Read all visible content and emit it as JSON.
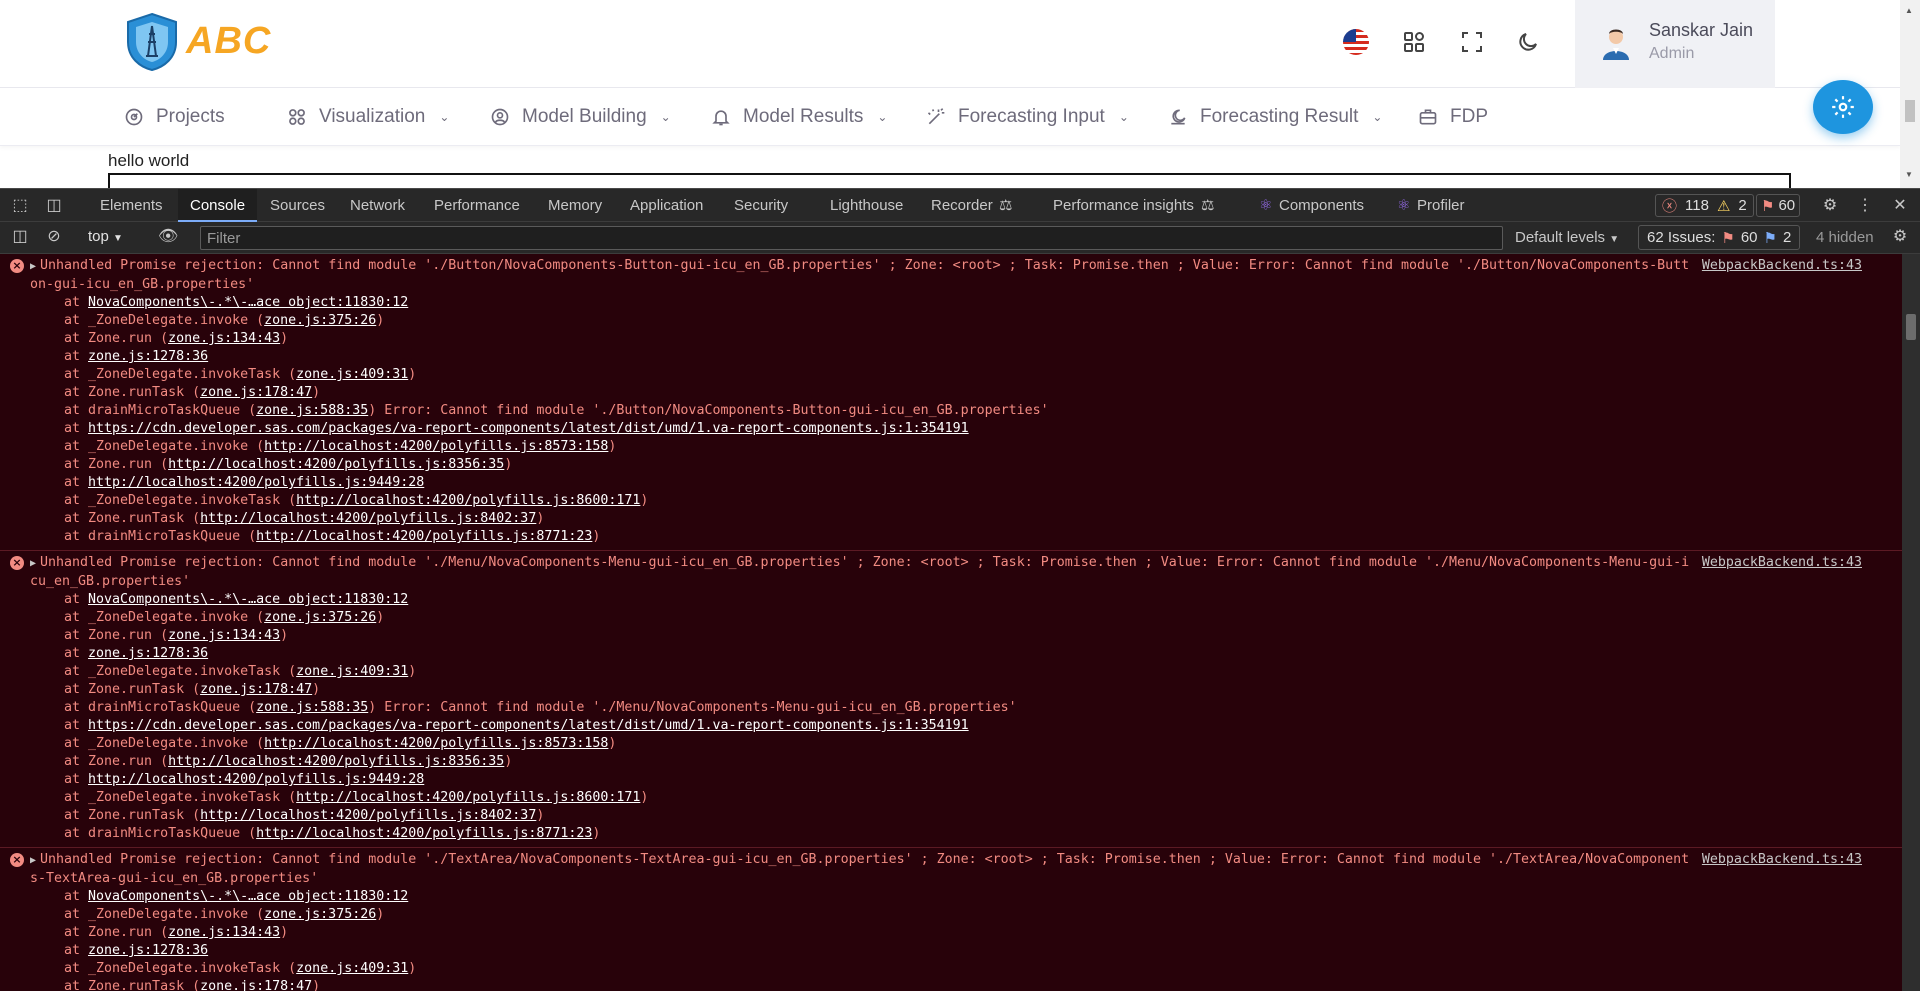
{
  "app": {
    "brand": "ABC",
    "user": {
      "name": "Sanskar Jain",
      "role": "Admin"
    },
    "nav": [
      {
        "label": "Projects",
        "icon": "target-icon",
        "has_chevron": false
      },
      {
        "label": "Visualization",
        "icon": "apps-icon",
        "has_chevron": true
      },
      {
        "label": "Model Building",
        "icon": "user-circle-icon",
        "has_chevron": true
      },
      {
        "label": "Model Results",
        "icon": "bell-icon",
        "has_chevron": true
      },
      {
        "label": "Forecasting Input",
        "icon": "magic-wand-icon",
        "has_chevron": true
      },
      {
        "label": "Forecasting Result",
        "icon": "crescent-chart-icon",
        "has_chevron": true
      },
      {
        "label": "FDP",
        "icon": "briefcase-icon",
        "has_chevron": false
      }
    ],
    "content_text": "hello world",
    "accent": "#1e95df",
    "brand_color": "#f6a623"
  },
  "devtools": {
    "tabs": [
      "Elements",
      "Console",
      "Sources",
      "Network",
      "Performance",
      "Memory",
      "Application",
      "Security",
      "Lighthouse",
      "Recorder",
      "Performance insights",
      "Components",
      "Profiler"
    ],
    "active_tab": "Console",
    "errors_count": "118",
    "warnings_count": "2",
    "messages_count": "60",
    "context": "top",
    "filter_placeholder": "Filter",
    "levels": "Default levels",
    "issues_label": "62 Issues:",
    "issues_errors": "60",
    "issues_info": "2",
    "hidden": "4 hidden",
    "messages": [
      {
        "head": "Unhandled Promise rejection: Cannot find module './Button/NovaComponents-Button-gui-icu_en_GB.properties' ; Zone: <root> ; Task: Promise.then ; Value: Error: Cannot find module './Button/NovaComponents-Button-gui-icu_en_GB.properties'",
        "source": "WebpackBackend.ts:43",
        "frames": [
          {
            "pre": "at ",
            "link": "NovaComponents\\-.*\\-…ace object:11830:12",
            "post": ""
          },
          {
            "pre": "at _ZoneDelegate.invoke (",
            "link": "zone.js:375:26",
            "post": ")"
          },
          {
            "pre": "at Zone.run (",
            "link": "zone.js:134:43",
            "post": ")"
          },
          {
            "pre": "at ",
            "link": "zone.js:1278:36",
            "post": ""
          },
          {
            "pre": "at _ZoneDelegate.invokeTask (",
            "link": "zone.js:409:31",
            "post": ")"
          },
          {
            "pre": "at Zone.runTask (",
            "link": "zone.js:178:47",
            "post": ")"
          },
          {
            "pre": "at drainMicroTaskQueue (",
            "link": "zone.js:588:35",
            "post": ") Error: Cannot find module './Button/NovaComponents-Button-gui-icu_en_GB.properties'"
          },
          {
            "pre": "at ",
            "link": "https://cdn.developer.sas.com/packages/va-report-components/latest/dist/umd/1.va-report-components.js:1:354191",
            "post": ""
          },
          {
            "pre": "at _ZoneDelegate.invoke (",
            "link": "http://localhost:4200/polyfills.js:8573:158",
            "post": ")"
          },
          {
            "pre": "at Zone.run (",
            "link": "http://localhost:4200/polyfills.js:8356:35",
            "post": ")"
          },
          {
            "pre": "at ",
            "link": "http://localhost:4200/polyfills.js:9449:28",
            "post": ""
          },
          {
            "pre": "at _ZoneDelegate.invokeTask (",
            "link": "http://localhost:4200/polyfills.js:8600:171",
            "post": ")"
          },
          {
            "pre": "at Zone.runTask (",
            "link": "http://localhost:4200/polyfills.js:8402:37",
            "post": ")"
          },
          {
            "pre": "at drainMicroTaskQueue (",
            "link": "http://localhost:4200/polyfills.js:8771:23",
            "post": ")"
          }
        ]
      },
      {
        "head": "Unhandled Promise rejection: Cannot find module './Menu/NovaComponents-Menu-gui-icu_en_GB.properties' ; Zone: <root> ; Task: Promise.then ; Value: Error: Cannot find module './Menu/NovaComponents-Menu-gui-icu_en_GB.properties'",
        "source": "WebpackBackend.ts:43",
        "frames": [
          {
            "pre": "at ",
            "link": "NovaComponents\\-.*\\-…ace object:11830:12",
            "post": ""
          },
          {
            "pre": "at _ZoneDelegate.invoke (",
            "link": "zone.js:375:26",
            "post": ")"
          },
          {
            "pre": "at Zone.run (",
            "link": "zone.js:134:43",
            "post": ")"
          },
          {
            "pre": "at ",
            "link": "zone.js:1278:36",
            "post": ""
          },
          {
            "pre": "at _ZoneDelegate.invokeTask (",
            "link": "zone.js:409:31",
            "post": ")"
          },
          {
            "pre": "at Zone.runTask (",
            "link": "zone.js:178:47",
            "post": ")"
          },
          {
            "pre": "at drainMicroTaskQueue (",
            "link": "zone.js:588:35",
            "post": ") Error: Cannot find module './Menu/NovaComponents-Menu-gui-icu_en_GB.properties'"
          },
          {
            "pre": "at ",
            "link": "https://cdn.developer.sas.com/packages/va-report-components/latest/dist/umd/1.va-report-components.js:1:354191",
            "post": ""
          },
          {
            "pre": "at _ZoneDelegate.invoke (",
            "link": "http://localhost:4200/polyfills.js:8573:158",
            "post": ")"
          },
          {
            "pre": "at Zone.run (",
            "link": "http://localhost:4200/polyfills.js:8356:35",
            "post": ")"
          },
          {
            "pre": "at ",
            "link": "http://localhost:4200/polyfills.js:9449:28",
            "post": ""
          },
          {
            "pre": "at _ZoneDelegate.invokeTask (",
            "link": "http://localhost:4200/polyfills.js:8600:171",
            "post": ")"
          },
          {
            "pre": "at Zone.runTask (",
            "link": "http://localhost:4200/polyfills.js:8402:37",
            "post": ")"
          },
          {
            "pre": "at drainMicroTaskQueue (",
            "link": "http://localhost:4200/polyfills.js:8771:23",
            "post": ")"
          }
        ]
      },
      {
        "head": "Unhandled Promise rejection: Cannot find module './TextArea/NovaComponents-TextArea-gui-icu_en_GB.properties' ; Zone: <root> ; Task: Promise.then ; Value: Error: Cannot find module './TextArea/NovaComponents-TextArea-gui-icu_en_GB.properties'",
        "source": "WebpackBackend.ts:43",
        "frames": [
          {
            "pre": "at ",
            "link": "NovaComponents\\-.*\\-…ace object:11830:12",
            "post": ""
          },
          {
            "pre": "at _ZoneDelegate.invoke (",
            "link": "zone.js:375:26",
            "post": ")"
          },
          {
            "pre": "at Zone.run (",
            "link": "zone.js:134:43",
            "post": ")"
          },
          {
            "pre": "at ",
            "link": "zone.js:1278:36",
            "post": ""
          },
          {
            "pre": "at _ZoneDelegate.invokeTask (",
            "link": "zone.js:409:31",
            "post": ")"
          },
          {
            "pre": "at Zone.runTask (",
            "link": "zone.js:178:47",
            "post": ")"
          }
        ]
      }
    ]
  }
}
